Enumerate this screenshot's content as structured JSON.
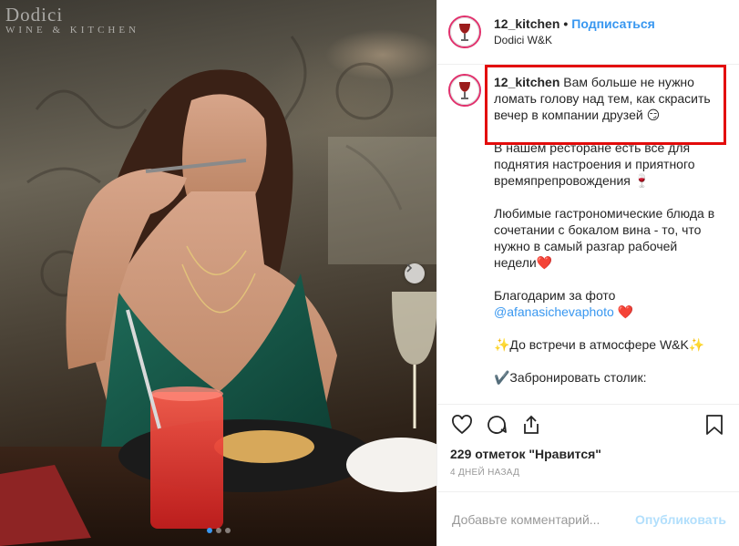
{
  "watermark": {
    "brand": "Dodici",
    "sub": "WINE & KITCHEN"
  },
  "header": {
    "username": "12_kitchen",
    "separator": "•",
    "follow_label": "Подписаться",
    "location": "Dodici W&K"
  },
  "caption": {
    "username": "12_kitchen",
    "paragraphs": [
      "Вам больше не нужно ломать голову над тем, как скрасить вечер в компании друзей 😏",
      "В нашем ресторане есть всё для поднятия настроения и приятного времяпрепровождения 🍷",
      "Любимые гастрономические блюда в сочетании с бокалом вина - то, что нужно в самый разгар рабочей недели❤️",
      "Благодарим за фото",
      "✨До встречи в атмосфере W&K✨",
      "✔️Забронировать столик:"
    ],
    "mention": "@afanasichevaphoto",
    "mention_suffix": " ❤️"
  },
  "actions": {
    "icons": [
      "heart-icon",
      "comment-icon",
      "share-icon",
      "bookmark-icon"
    ]
  },
  "likes_text": "229 отметок \"Нравится\"",
  "timestamp": "4 ДНЕЙ НАЗАД",
  "comment": {
    "placeholder": "Добавьте комментарий...",
    "publish_label": "Опубликовать"
  },
  "carousel": {
    "dots": 3,
    "active_index": 0
  },
  "colors": {
    "link": "#3897f0",
    "highlight": "#e30b0b",
    "publish_disabled": "#b2dffc"
  }
}
